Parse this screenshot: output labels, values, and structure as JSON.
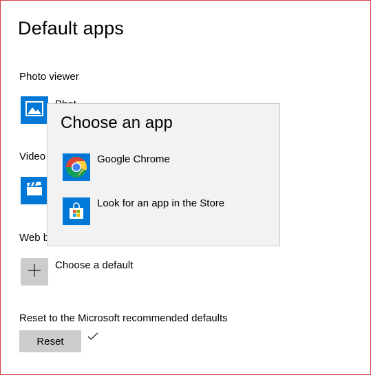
{
  "page": {
    "title": "Default apps"
  },
  "sections": {
    "photo_viewer": {
      "label": "Photo viewer",
      "app_name": "Phot",
      "icon": "photo-icon"
    },
    "video_player": {
      "label": "Video",
      "icon": "film-clapper-icon"
    },
    "web_browser": {
      "label": "Web b",
      "app_name": "Choose a default",
      "icon": "plus-icon"
    }
  },
  "reset": {
    "label": "Reset to the Microsoft recommended defaults",
    "button_label": "Reset",
    "status_icon": "checkmark-icon"
  },
  "flyout": {
    "title": "Choose an app",
    "items": [
      {
        "label": "Google Chrome",
        "icon": "chrome-icon"
      },
      {
        "label": "Look for an app in the Store",
        "icon": "store-icon"
      }
    ]
  },
  "colors": {
    "accent": "#0078d7",
    "flyout_bg": "#f2f2f2",
    "tile_gray": "#cccccc"
  }
}
